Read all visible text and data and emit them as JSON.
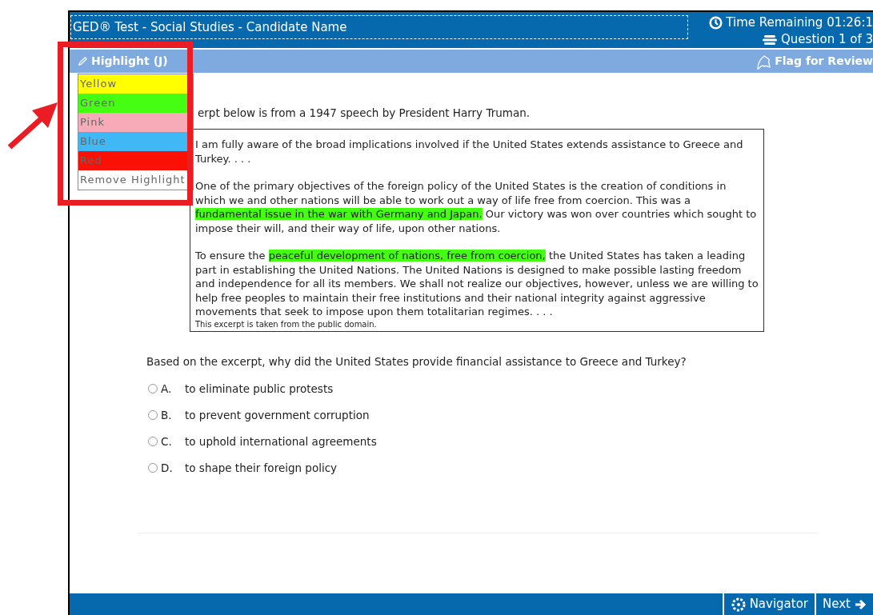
{
  "header": {
    "title": "GED® Test - Social Studies - Candidate Name",
    "time_remaining": "Time Remaining 01:26:1",
    "question_counter": "Question 1 of 3"
  },
  "toolbar": {
    "highlight_button": "Highlight (J)",
    "flag_button": "Flag for Review"
  },
  "highlight_menu": [
    {
      "label": "Yellow",
      "color": "#ffff00"
    },
    {
      "label": "Green",
      "color": "#44ff11"
    },
    {
      "label": "Pink",
      "color": "#f7aab8"
    },
    {
      "label": "Blue",
      "color": "#3fb8f5"
    },
    {
      "label": "Red",
      "color": "#fb1005"
    },
    {
      "label": "Remove Highlight",
      "color": "#ffffff"
    }
  ],
  "intro": "erpt below is from a 1947 speech by President Harry Truman.",
  "passage": {
    "paragraphs": [
      [
        {
          "text": "I am fully aware of the broad implications involved if the United States extends assistance to Greece and Turkey. . . .",
          "highlighted": false
        }
      ],
      [
        {
          "text": "One of the primary objectives of the foreign policy of the United States is the creation of conditions in which we and other nations will be able to work out a way of life free from coercion. This was a ",
          "highlighted": false
        },
        {
          "text": "fundamental issue in the war with Germany and Japan.",
          "highlighted": true
        },
        {
          "text": " Our victory was won over countries which sought to impose their will, and their way of life, upon other nations.",
          "highlighted": false
        }
      ],
      [
        {
          "text": "To ensure the ",
          "highlighted": false
        },
        {
          "text": "peaceful development of nations, free from coercion,",
          "highlighted": true
        },
        {
          "text": " the United States has taken a leading part in establishing the United Nations. The United Nations is designed to make possible lasting freedom and independence for all its members. We shall not realize our objectives, however, unless we are willing to help free peoples to maintain their free institutions and their national integrity against aggressive movements that seek to impose upon them totalitarian regimes. . . .",
          "highlighted": false
        }
      ]
    ],
    "source_note": "This excerpt is taken from the public domain."
  },
  "question": "Based on the excerpt, why did the United States provide financial assistance to Greece and Turkey?",
  "options": [
    {
      "letter": "A.",
      "text": "to eliminate public protests",
      "selected": false
    },
    {
      "letter": "B.",
      "text": "to prevent government corruption",
      "selected": false
    },
    {
      "letter": "C.",
      "text": "to uphold international agreements",
      "selected": false
    },
    {
      "letter": "D.",
      "text": "to shape their foreign policy",
      "selected": false
    }
  ],
  "footer": {
    "navigator_button": "Navigator",
    "next_button": "Next"
  }
}
